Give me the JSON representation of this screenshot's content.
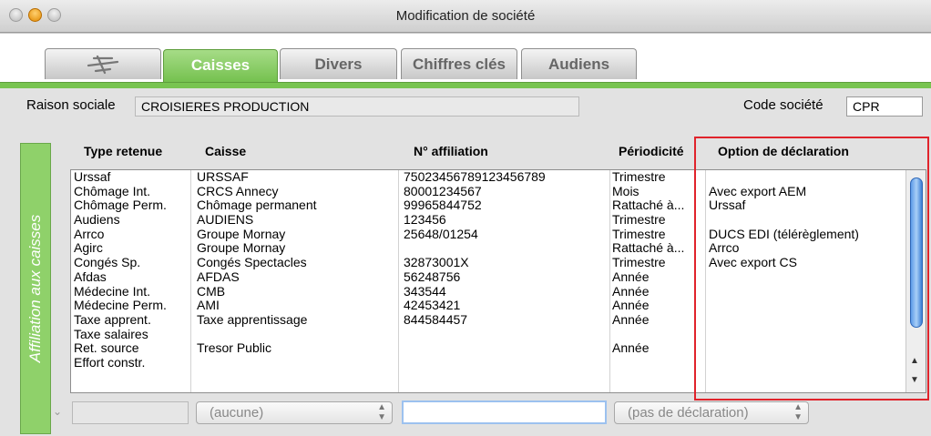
{
  "window": {
    "title": "Modification de société"
  },
  "tabs": [
    {
      "label": ""
    },
    {
      "label": "Caisses"
    },
    {
      "label": "Divers"
    },
    {
      "label": "Chiffres clés"
    },
    {
      "label": "Audiens"
    }
  ],
  "header": {
    "raison_label": "Raison sociale",
    "raison_value": "CROISIERES PRODUCTION",
    "code_label": "Code société",
    "code_value": "CPR"
  },
  "section": {
    "label": "Affiliation aux caisses"
  },
  "table": {
    "columns": [
      "Type retenue",
      "Caisse",
      "N° affiliation",
      "Périodicité",
      "Option de déclaration"
    ],
    "rows": [
      [
        "Urssaf",
        "URSSAF",
        "75023456789123456789",
        "Trimestre",
        ""
      ],
      [
        "Chômage Int.",
        "CRCS Annecy",
        "80001234567",
        "Mois",
        "Avec export AEM"
      ],
      [
        "Chômage Perm.",
        "Chômage permanent",
        "99965844752",
        "Rattaché à...",
        "Urssaf"
      ],
      [
        "Audiens",
        "AUDIENS",
        "123456",
        "Trimestre",
        ""
      ],
      [
        "Arrco",
        "Groupe Mornay",
        "25648/01254",
        "Trimestre",
        "DUCS EDI (télérèglement)"
      ],
      [
        "Agirc",
        "Groupe Mornay",
        "",
        "Rattaché à...",
        "Arrco"
      ],
      [
        "Congés Sp.",
        "Congés Spectacles",
        "32873001X",
        "Trimestre",
        "Avec export CS"
      ],
      [
        "Afdas",
        "AFDAS",
        "56248756",
        "Année",
        ""
      ],
      [
        "Médecine Int.",
        "CMB",
        "343544",
        "Année",
        ""
      ],
      [
        "Médecine Perm.",
        "AMI",
        "42453421",
        "Année",
        ""
      ],
      [
        "Taxe apprent.",
        "Taxe apprentissage",
        "844584457",
        "Année",
        ""
      ],
      [
        "Taxe salaires",
        "",
        "",
        "",
        ""
      ],
      [
        "Ret. source",
        "Tresor Public",
        "",
        "Année",
        ""
      ],
      [
        "Effort constr.",
        "",
        "",
        "",
        ""
      ]
    ]
  },
  "editor": {
    "caisse_value": "(aucune)",
    "affiliation_value": "",
    "declaration_value": "(pas de déclaration)"
  }
}
